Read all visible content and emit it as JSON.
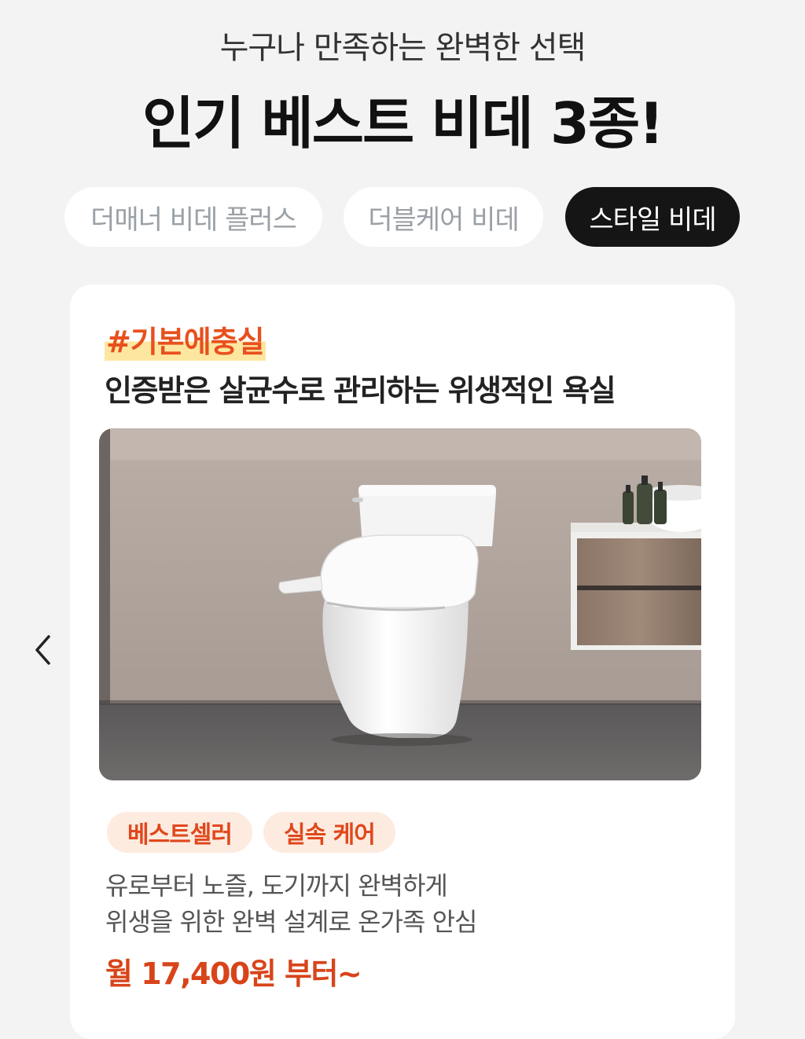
{
  "header": {
    "subtitle": "누구나 만족하는 완벽한 선택",
    "title": "인기 베스트 비데 3종!"
  },
  "tabs": [
    {
      "label": "더매너 비데 플러스",
      "selected": false
    },
    {
      "label": "더블케어 비데",
      "selected": false
    },
    {
      "label": "스타일 비데",
      "selected": true
    }
  ],
  "card": {
    "hashtag": "#기본에충실",
    "headline": "인증받은 살균수로 관리하는 위생적인 욕실",
    "image_icon": "toilet-bidet-product-photo",
    "badges": [
      "베스트셀러",
      "실속 케어"
    ],
    "description": [
      "유로부터 노즐, 도기까지 완벽하게",
      "위생을 위한 완벽 설계로 온가족 안심"
    ],
    "price": "월 17,400원 부터~"
  },
  "navigation": {
    "prev_icon": "chevron-left-icon"
  },
  "colors": {
    "background": "#f2f3f2",
    "accent": "#e0481c",
    "selected_tab": "#151515",
    "highlight": "#fde7a0"
  }
}
